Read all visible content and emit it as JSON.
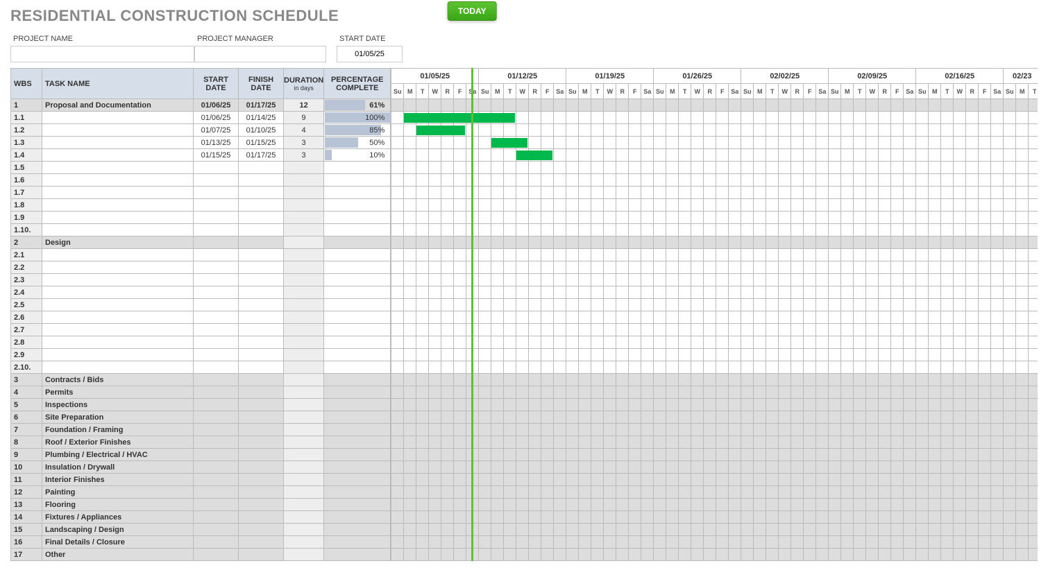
{
  "title": "RESIDENTIAL CONSTRUCTION SCHEDULE",
  "meta": {
    "project_label": "PROJECT NAME",
    "project_value": "",
    "manager_label": "PROJECT MANAGER",
    "manager_value": "",
    "start_label": "START DATE",
    "start_value": "01/05/25"
  },
  "today_label": "TODAY",
  "today_day_index": 6,
  "headers": {
    "wbs": "WBS",
    "task": "TASK NAME",
    "start": "START DATE",
    "finish": "FINISH DATE",
    "duration": "DURATION",
    "duration_sub": "in days",
    "pct": "PERCENTAGE COMPLETE"
  },
  "weeks": [
    "01/05/25",
    "01/12/25",
    "01/19/25",
    "01/26/25",
    "02/02/25",
    "02/09/25",
    "02/16/25",
    "02/23"
  ],
  "days": [
    "Su",
    "M",
    "T",
    "W",
    "R",
    "F",
    "Sa"
  ],
  "rows": [
    {
      "wbs": "1",
      "task": "Proposal and Documentation",
      "start": "01/06/25",
      "finish": "01/17/25",
      "dur": "12",
      "pct": "61%",
      "pct_w": 61,
      "section": true
    },
    {
      "wbs": "1.1",
      "task": "",
      "start": "01/06/25",
      "finish": "01/14/25",
      "dur": "9",
      "pct": "100%",
      "pct_w": 100,
      "bar_start": 1,
      "bar_len": 9
    },
    {
      "wbs": "1.2",
      "task": "",
      "start": "01/07/25",
      "finish": "01/10/25",
      "dur": "4",
      "pct": "85%",
      "pct_w": 85,
      "bar_start": 2,
      "bar_len": 4
    },
    {
      "wbs": "1.3",
      "task": "",
      "start": "01/13/25",
      "finish": "01/15/25",
      "dur": "3",
      "pct": "50%",
      "pct_w": 50,
      "bar_start": 8,
      "bar_len": 3
    },
    {
      "wbs": "1.4",
      "task": "",
      "start": "01/15/25",
      "finish": "01/17/25",
      "dur": "3",
      "pct": "10%",
      "pct_w": 10,
      "bar_start": 10,
      "bar_len": 3
    },
    {
      "wbs": "1.5",
      "task": "",
      "start": "",
      "finish": "",
      "dur": "",
      "pct": "",
      "pct_w": 0
    },
    {
      "wbs": "1.6",
      "task": "",
      "start": "",
      "finish": "",
      "dur": "",
      "pct": "",
      "pct_w": 0
    },
    {
      "wbs": "1.7",
      "task": "",
      "start": "",
      "finish": "",
      "dur": "",
      "pct": "",
      "pct_w": 0
    },
    {
      "wbs": "1.8",
      "task": "",
      "start": "",
      "finish": "",
      "dur": "",
      "pct": "",
      "pct_w": 0
    },
    {
      "wbs": "1.9",
      "task": "",
      "start": "",
      "finish": "",
      "dur": "",
      "pct": "",
      "pct_w": 0
    },
    {
      "wbs": "1.10.",
      "task": "",
      "start": "",
      "finish": "",
      "dur": "",
      "pct": "",
      "pct_w": 0
    },
    {
      "wbs": "2",
      "task": "Design",
      "start": "",
      "finish": "",
      "dur": "",
      "pct": "",
      "pct_w": 0,
      "section": true
    },
    {
      "wbs": "2.1",
      "task": "",
      "start": "",
      "finish": "",
      "dur": "",
      "pct": "",
      "pct_w": 0
    },
    {
      "wbs": "2.2",
      "task": "",
      "start": "",
      "finish": "",
      "dur": "",
      "pct": "",
      "pct_w": 0
    },
    {
      "wbs": "2.3",
      "task": "",
      "start": "",
      "finish": "",
      "dur": "",
      "pct": "",
      "pct_w": 0
    },
    {
      "wbs": "2.4",
      "task": "",
      "start": "",
      "finish": "",
      "dur": "",
      "pct": "",
      "pct_w": 0
    },
    {
      "wbs": "2.5",
      "task": "",
      "start": "",
      "finish": "",
      "dur": "",
      "pct": "",
      "pct_w": 0
    },
    {
      "wbs": "2.6",
      "task": "",
      "start": "",
      "finish": "",
      "dur": "",
      "pct": "",
      "pct_w": 0
    },
    {
      "wbs": "2.7",
      "task": "",
      "start": "",
      "finish": "",
      "dur": "",
      "pct": "",
      "pct_w": 0
    },
    {
      "wbs": "2.8",
      "task": "",
      "start": "",
      "finish": "",
      "dur": "",
      "pct": "",
      "pct_w": 0
    },
    {
      "wbs": "2.9",
      "task": "",
      "start": "",
      "finish": "",
      "dur": "",
      "pct": "",
      "pct_w": 0
    },
    {
      "wbs": "2.10.",
      "task": "",
      "start": "",
      "finish": "",
      "dur": "",
      "pct": "",
      "pct_w": 0
    },
    {
      "wbs": "3",
      "task": "Contracts / Bids",
      "start": "",
      "finish": "",
      "dur": "",
      "pct": "",
      "pct_w": 0,
      "section": true
    },
    {
      "wbs": "4",
      "task": "Permits",
      "start": "",
      "finish": "",
      "dur": "",
      "pct": "",
      "pct_w": 0,
      "section": true
    },
    {
      "wbs": "5",
      "task": "Inspections",
      "start": "",
      "finish": "",
      "dur": "",
      "pct": "",
      "pct_w": 0,
      "section": true
    },
    {
      "wbs": "6",
      "task": "Site Preparation",
      "start": "",
      "finish": "",
      "dur": "",
      "pct": "",
      "pct_w": 0,
      "section": true
    },
    {
      "wbs": "7",
      "task": "Foundation / Framing",
      "start": "",
      "finish": "",
      "dur": "",
      "pct": "",
      "pct_w": 0,
      "section": true
    },
    {
      "wbs": "8",
      "task": "Roof / Exterior Finishes",
      "start": "",
      "finish": "",
      "dur": "",
      "pct": "",
      "pct_w": 0,
      "section": true
    },
    {
      "wbs": "9",
      "task": "Plumbing / Electrical / HVAC",
      "start": "",
      "finish": "",
      "dur": "",
      "pct": "",
      "pct_w": 0,
      "section": true
    },
    {
      "wbs": "10",
      "task": "Insulation / Drywall",
      "start": "",
      "finish": "",
      "dur": "",
      "pct": "",
      "pct_w": 0,
      "section": true
    },
    {
      "wbs": "11",
      "task": "Interior Finishes",
      "start": "",
      "finish": "",
      "dur": "",
      "pct": "",
      "pct_w": 0,
      "section": true
    },
    {
      "wbs": "12",
      "task": "Painting",
      "start": "",
      "finish": "",
      "dur": "",
      "pct": "",
      "pct_w": 0,
      "section": true
    },
    {
      "wbs": "13",
      "task": "Flooring",
      "start": "",
      "finish": "",
      "dur": "",
      "pct": "",
      "pct_w": 0,
      "section": true
    },
    {
      "wbs": "14",
      "task": "Fixtures / Appliances",
      "start": "",
      "finish": "",
      "dur": "",
      "pct": "",
      "pct_w": 0,
      "section": true
    },
    {
      "wbs": "15",
      "task": "Landscaping / Design",
      "start": "",
      "finish": "",
      "dur": "",
      "pct": "",
      "pct_w": 0,
      "section": true
    },
    {
      "wbs": "16",
      "task": "Final Details / Closure",
      "start": "",
      "finish": "",
      "dur": "",
      "pct": "",
      "pct_w": 0,
      "section": true
    },
    {
      "wbs": "17",
      "task": "Other",
      "start": "",
      "finish": "",
      "dur": "",
      "pct": "",
      "pct_w": 0,
      "section": true
    }
  ]
}
